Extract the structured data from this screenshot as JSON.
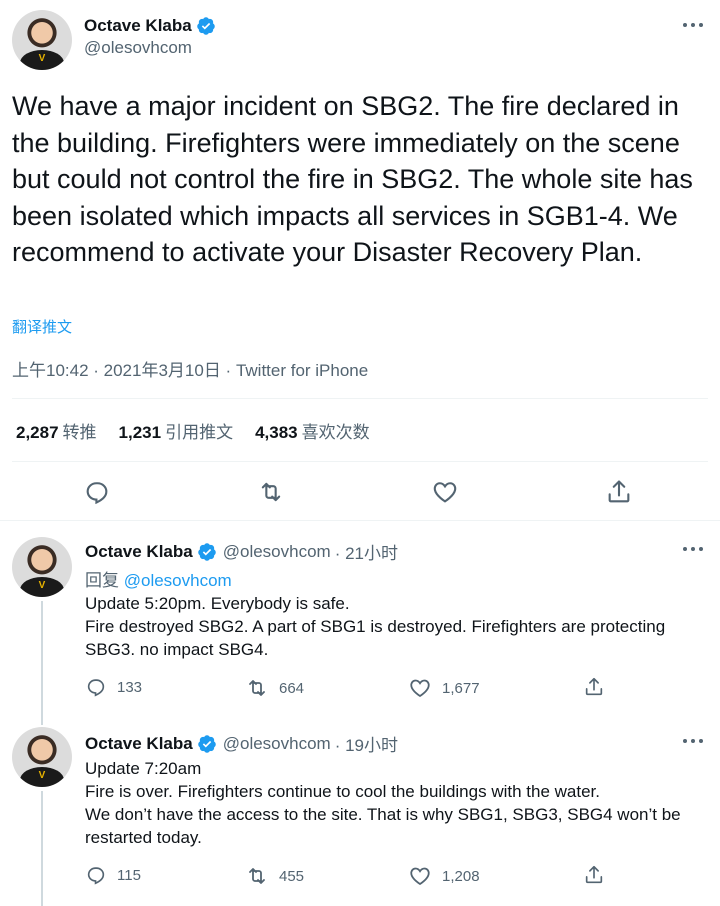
{
  "main_tweet": {
    "author_name": "Octave Klaba",
    "author_handle": "@olesovhcom",
    "text": "We have a major incident on SBG2. The fire declared in the building. Firefighters were immediately on the scene but could not control the fire in SBG2. The whole site has been isolated which impacts all services in SGB1-4. We recommend to activate your Disaster Recovery Plan.",
    "translate_label": "翻译推文",
    "meta": "上午10:42 · 2021年3月10日 · Twitter for iPhone",
    "stats": [
      {
        "value": "2,287",
        "label": "转推"
      },
      {
        "value": "1,231",
        "label": "引用推文"
      },
      {
        "value": "4,383",
        "label": "喜欢次数"
      }
    ]
  },
  "replies": [
    {
      "author_name": "Octave Klaba",
      "author_handle": "@olesovhcom",
      "time": "· 21小时",
      "reply_prefix": "回复",
      "reply_to": "@olesovhcom",
      "lines": [
        "Update 5:20pm. Everybody is safe.",
        "Fire destroyed SBG2. A part of SBG1 is destroyed. Firefighters are protecting",
        "SBG3. no impact SBG4."
      ],
      "replies_count": "133",
      "retweets_count": "664",
      "likes_count": "1,677"
    },
    {
      "author_name": "Octave Klaba",
      "author_handle": "@olesovhcom",
      "time": "· 19小时",
      "lines": [
        "Update 7:20am",
        "Fire is over. Firefighters continue to cool the buildings with the water.",
        "We don’t have the access to the site. That is why SBG1, SBG3, SBG4 won’t be",
        "restarted today."
      ],
      "replies_count": "115",
      "retweets_count": "455",
      "likes_count": "1,208"
    }
  ],
  "colors": {
    "accent": "#1d9bf0",
    "secondary_text": "#536471",
    "divider": "#eff3f4"
  },
  "icons": [
    "verified-badge-icon",
    "more-icon",
    "reply-icon",
    "retweet-icon",
    "like-icon",
    "share-icon"
  ]
}
